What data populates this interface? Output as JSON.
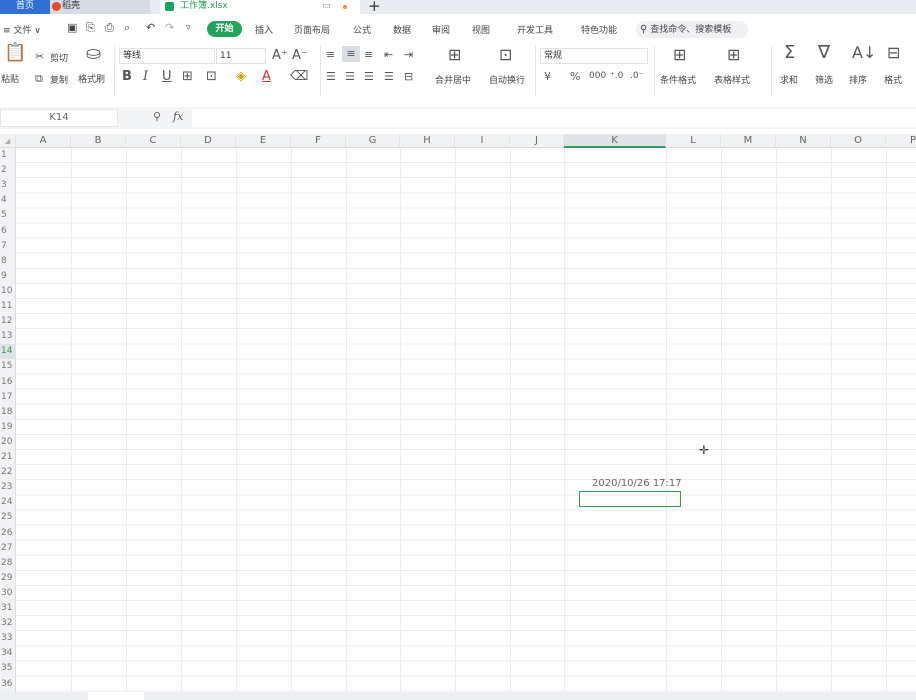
{
  "tabs": {
    "home": "首页",
    "daoke": "稻壳",
    "workbook": "工作簿.xlsx"
  },
  "menu": {
    "file": "≡ 文件 ∨",
    "start": "开始",
    "items": [
      "插入",
      "页面布局",
      "公式",
      "数据",
      "审阅",
      "视图",
      "开发工具",
      "特色功能"
    ],
    "search": "查找命令、搜索模板"
  },
  "ribbon": {
    "paste": "粘贴",
    "cut": "剪切",
    "copy": "复制",
    "format_painter": "格式刷",
    "font_name": "等线",
    "font_size": "11",
    "merge_center": "合并居中",
    "wrap_text": "自动换行",
    "number_format": "常规",
    "cond_format": "条件格式",
    "table_style": "表格样式",
    "sum": "求和",
    "filter": "筛选",
    "sort": "排序",
    "format": "格式"
  },
  "formula_bar": {
    "name_box": "K14",
    "fx": "fx"
  },
  "columns": [
    "A",
    "B",
    "C",
    "D",
    "E",
    "F",
    "G",
    "H",
    "I",
    "J",
    "K",
    "L",
    "M",
    "N",
    "O",
    "P"
  ],
  "rows": [
    "1",
    "2",
    "3",
    "4",
    "5",
    "6",
    "7",
    "8",
    "9",
    "10",
    "11",
    "12",
    "13",
    "14",
    "15",
    "16",
    "17",
    "18",
    "19",
    "20",
    "21",
    "22",
    "23",
    "24",
    "25",
    "26",
    "27",
    "28",
    "29",
    "30",
    "31",
    "32",
    "33",
    "34",
    "35",
    "36"
  ],
  "cells": {
    "K13": "2020/10/26 17:17"
  },
  "selected_cell": "K14",
  "colors": {
    "accent_green": "#23a45b",
    "tab_blue": "#2f6fd6",
    "selection": "#2e9e4f"
  }
}
